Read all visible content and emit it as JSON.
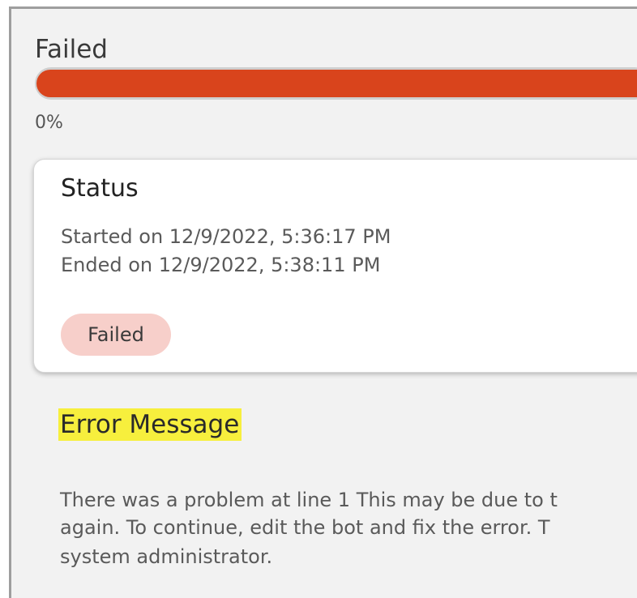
{
  "run": {
    "status_label": "Failed",
    "progress_percent_text": "0%",
    "progress_fraction": 0,
    "progress_bar_color": "#d9441c"
  },
  "status_card": {
    "title": "Status",
    "started": "Started on 12/9/2022, 5:36:17 PM",
    "ended": "Ended on 12/9/2022, 5:38:11 PM",
    "badge": "Failed",
    "badge_color": "#f7cfca"
  },
  "error": {
    "heading": "Error Message",
    "heading_highlight_color": "#f7ef3d",
    "lines": [
      "There was a problem at line 1 This may be due to t",
      "again. To continue, edit the bot and fix the error. T",
      "system administrator."
    ]
  }
}
